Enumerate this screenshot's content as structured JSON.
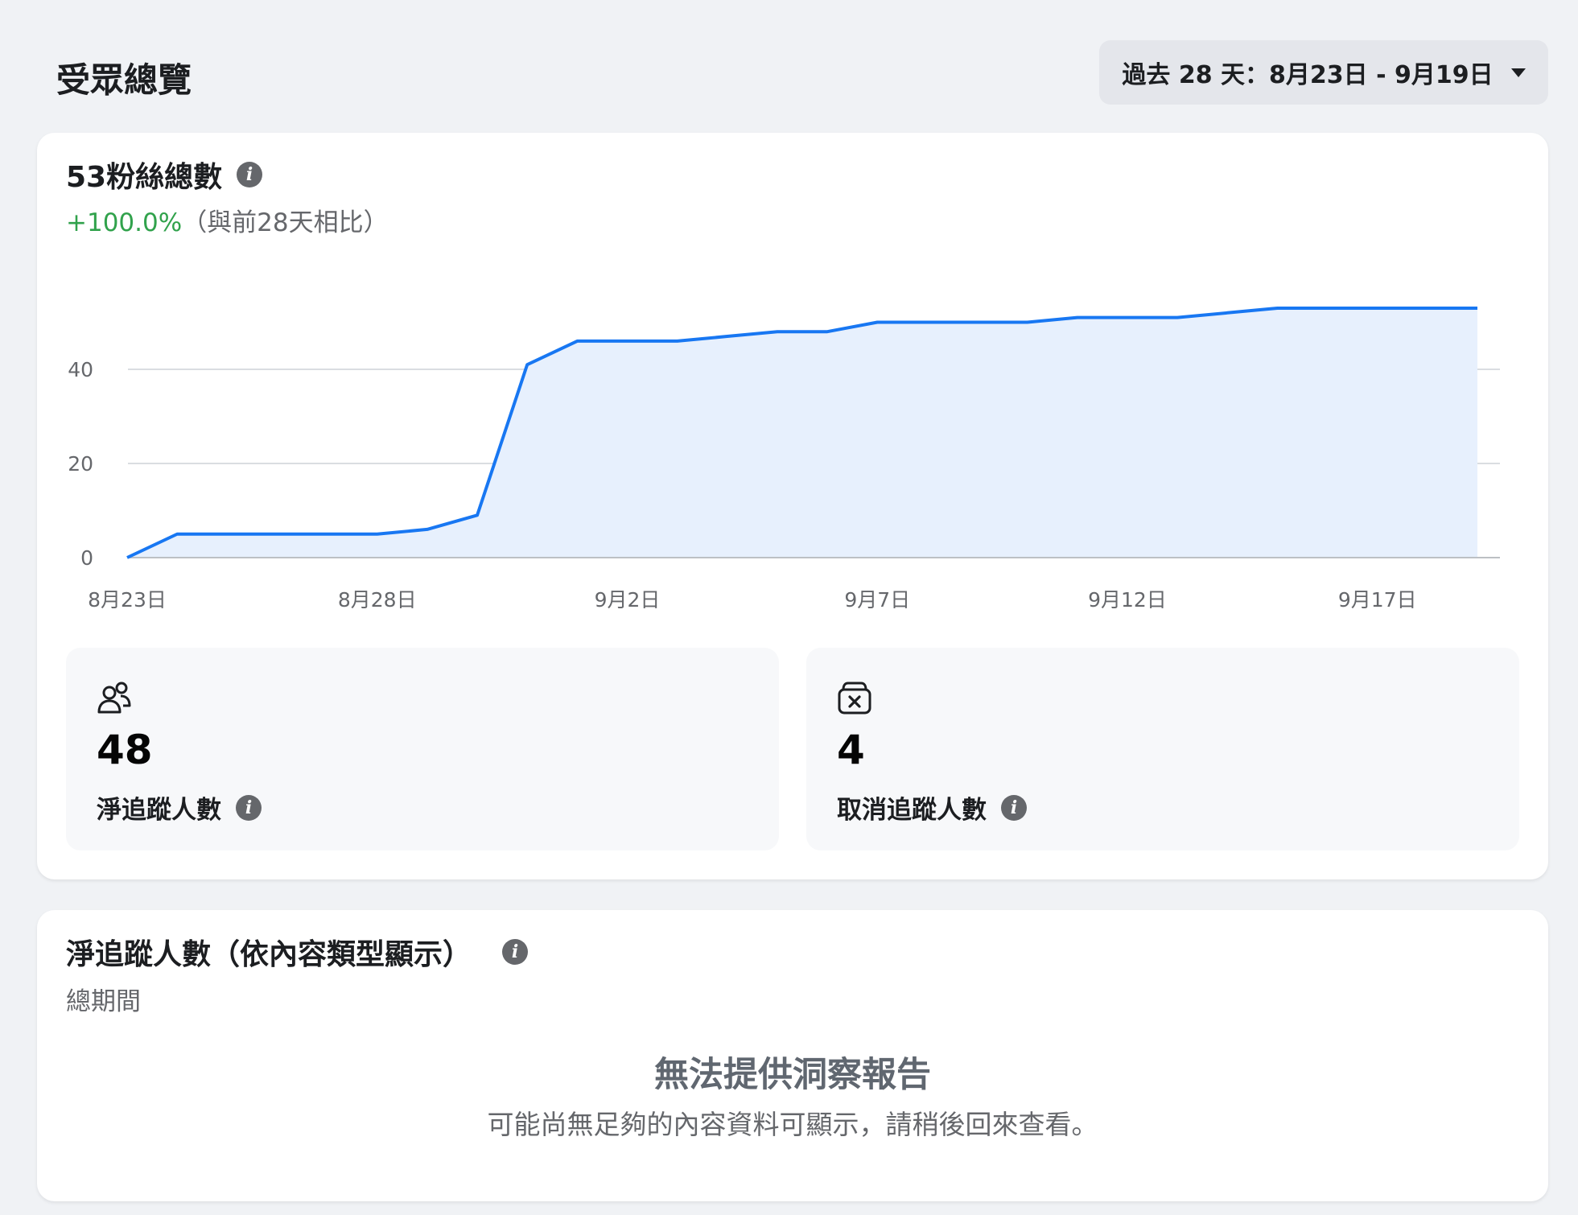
{
  "page": {
    "title": "受眾總覽",
    "date_range_label": "過去 28 天：8月23日 - 9月19日"
  },
  "followers_card": {
    "title": "53粉絲總數",
    "change_value": "+100.0%",
    "change_note": "（與前28天相比）",
    "stats": [
      {
        "icon": "people-icon",
        "value": "48",
        "label": "淨追蹤人數"
      },
      {
        "icon": "unfollow-icon",
        "value": "4",
        "label": "取消追蹤人數"
      }
    ]
  },
  "content_type_card": {
    "title": "淨追蹤人數（依內容類型顯示）",
    "subtitle": "總期間",
    "empty_title": "無法提供洞察報告",
    "empty_message": "可能尚無足夠的內容資料可顯示，請稍後回來查看。"
  },
  "chart_data": {
    "type": "area",
    "x": [
      "8月23日",
      "8月24日",
      "8月25日",
      "8月26日",
      "8月27日",
      "8月28日",
      "8月29日",
      "8月30日",
      "8月31日",
      "9月1日",
      "9月2日",
      "9月3日",
      "9月4日",
      "9月5日",
      "9月6日",
      "9月7日",
      "9月8日",
      "9月9日",
      "9月10日",
      "9月11日",
      "9月12日",
      "9月13日",
      "9月14日",
      "9月15日",
      "9月16日",
      "9月17日",
      "9月18日",
      "9月19日"
    ],
    "x_tick_labels": [
      "8月23日",
      "8月28日",
      "9月2日",
      "9月7日",
      "9月12日",
      "9月17日"
    ],
    "values": [
      0,
      5,
      5,
      5,
      5,
      5,
      6,
      9,
      41,
      46,
      46,
      46,
      47,
      48,
      48,
      50,
      50,
      50,
      50,
      51,
      51,
      51,
      52,
      53,
      53,
      53,
      53,
      53
    ],
    "yticks": [
      0,
      20,
      40
    ],
    "ylim": [
      0,
      60
    ],
    "line_color": "#1877f2",
    "fill_color": "#e7f0fd",
    "grid": true
  }
}
